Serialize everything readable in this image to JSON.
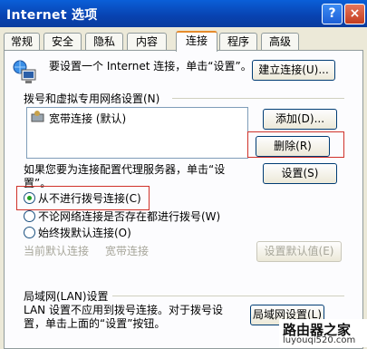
{
  "window": {
    "title": "Internet 选项",
    "help": "?",
    "close": "×"
  },
  "tabs": [
    "常规",
    "安全",
    "隐私",
    "内容",
    "连接",
    "程序",
    "高级"
  ],
  "setup": {
    "text": "要设置一个 Internet 连接，单击“设置”。",
    "button": "建立连接(U)..."
  },
  "dialup": {
    "heading": "拨号和虚拟专用网络设置(N)",
    "list": [
      "宽带连接 (默认)"
    ],
    "add": "添加(D)...",
    "remove": "删除(R)",
    "settings": "设置(S)",
    "proxy_text": "如果您要为连接配置代理服务器，单击“设置”。",
    "options": [
      "从不进行拨号连接(C)",
      "不论网络连接是否存在都进行拨号(W)",
      "始终拨默认连接(O)"
    ],
    "selected_option": "从不进行拨号连接(C)",
    "current_default_label": "当前默认连接",
    "current_default_value": "宽带连接",
    "set_default": "设置默认值(E)"
  },
  "lan": {
    "heading": "局域网(LAN)设置",
    "text_line1": "LAN 设置不应用到拨号连接。对于拨号设",
    "text_line2": "置，单击上面的“设置”按钮。",
    "button": "局域网设置(L)"
  },
  "watermark": {
    "line1": "路由器之家",
    "line2": "luyouqi520.com"
  },
  "colors": {
    "highlight": "#d0322a",
    "titlebar": "#0842b0",
    "tab_accent": "#e68b2c"
  }
}
